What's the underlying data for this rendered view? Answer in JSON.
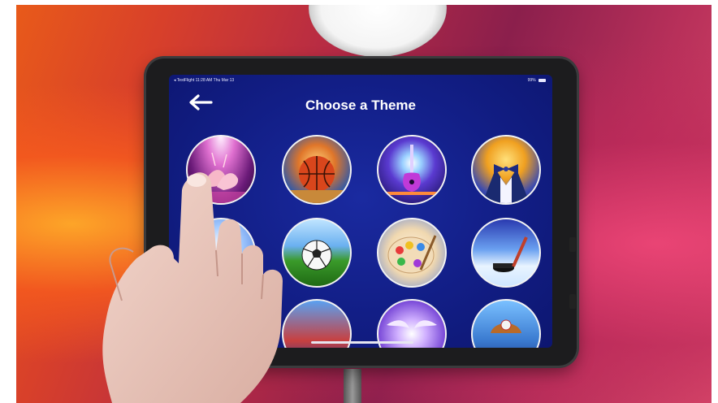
{
  "status_bar": {
    "left": "◂ TestFlight  11:28 AM  Thu Mar 13",
    "battery": "99%"
  },
  "header": {
    "title": "Choose a Theme"
  },
  "themes": [
    {
      "icon": "ballet-shoes-icon"
    },
    {
      "icon": "basketball-icon"
    },
    {
      "icon": "electric-guitar-icon"
    },
    {
      "icon": "tuxedo-bowtie-icon"
    },
    {
      "icon": "partial-theme-icon"
    },
    {
      "icon": "soccer-ball-icon"
    },
    {
      "icon": "paint-palette-icon"
    },
    {
      "icon": "hockey-puck-icon"
    },
    {
      "icon": "partial-theme-icon"
    },
    {
      "icon": "partial-theme-icon"
    },
    {
      "icon": "angel-wings-icon"
    },
    {
      "icon": "baseball-glove-icon"
    }
  ],
  "colors": {
    "screen_bg": "#121e86",
    "title": "#ffffff",
    "circle_border": "#f2f2f2"
  }
}
